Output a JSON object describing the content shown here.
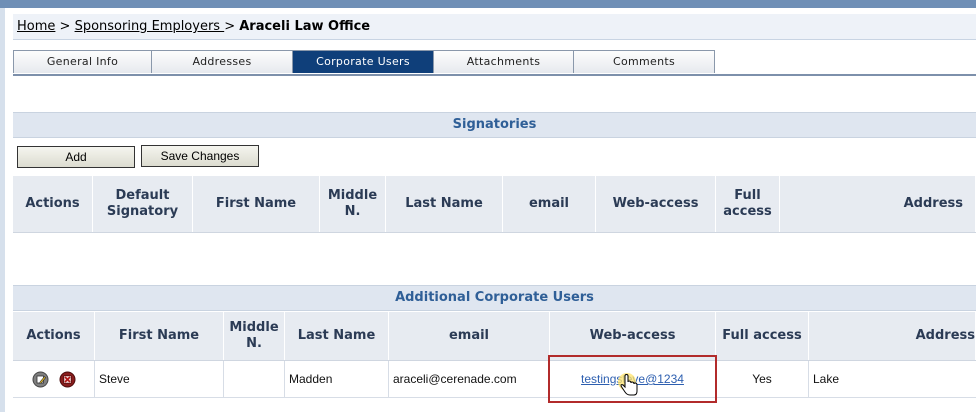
{
  "breadcrumb": {
    "home": "Home",
    "sep1": " > ",
    "employers": "Sponsoring Employers ",
    "sep2": " > ",
    "current": "Araceli Law Office"
  },
  "tabs": [
    {
      "label": "General Info",
      "active": false
    },
    {
      "label": "Addresses",
      "active": false
    },
    {
      "label": "Corporate Users",
      "active": true
    },
    {
      "label": "Attachments",
      "active": false
    },
    {
      "label": "Comments",
      "active": false
    }
  ],
  "signatories": {
    "title": "Signatories",
    "add_label": "Add",
    "save_label": "Save Changes",
    "columns": [
      "Actions",
      "Default Signatory",
      "First Name",
      "Middle N.",
      "Last Name",
      "email",
      "Web-access",
      "Full access",
      "Address"
    ]
  },
  "additional": {
    "title": "Additional Corporate Users",
    "columns": [
      "Actions",
      "First Name",
      "Middle N.",
      "Last Name",
      "email",
      "Web-access",
      "Full access",
      "Address"
    ],
    "rows": [
      {
        "edit_icon": "edit-icon",
        "delete_icon": "delete-icon",
        "first_name": "Steve",
        "middle": "",
        "last_name": "Madden",
        "email": "araceli@cerenade.com",
        "web_access": "testingsteve@1234",
        "full_access": "Yes",
        "address": "Lake"
      }
    ]
  },
  "colors": {
    "accent": "#0f3f7a",
    "header_text": "#2f5f97",
    "highlight": "#b22b2b"
  }
}
